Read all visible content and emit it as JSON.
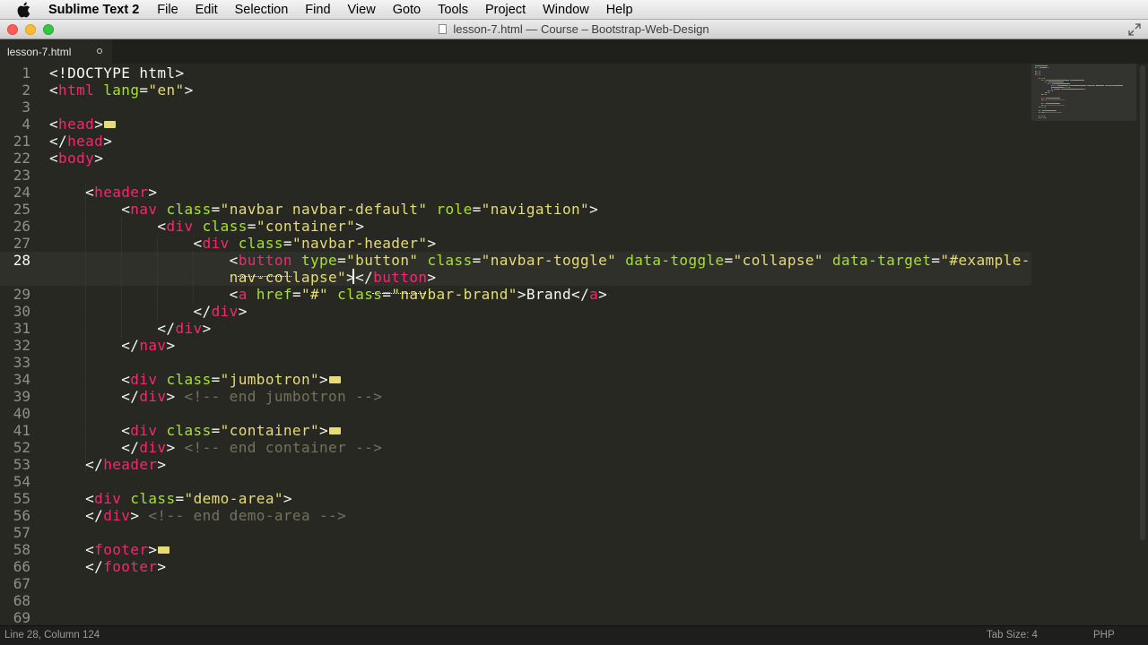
{
  "menubar": {
    "app_name": "Sublime Text 2",
    "items": [
      "File",
      "Edit",
      "Selection",
      "Find",
      "View",
      "Goto",
      "Tools",
      "Project",
      "Window",
      "Help"
    ]
  },
  "window": {
    "title": "lesson-7.html — Course – Bootstrap-Web-Design"
  },
  "tab": {
    "label": "lesson-7.html",
    "dirty": true
  },
  "editor": {
    "current_line": "28",
    "lines": [
      {
        "n": "1",
        "tokens": [
          [
            "pun",
            "<!DOCTYPE html>"
          ]
        ]
      },
      {
        "n": "2",
        "tokens": [
          [
            "pun",
            "<"
          ],
          [
            "tag",
            "html"
          ],
          [
            "pun",
            " "
          ],
          [
            "attr",
            "lang"
          ],
          [
            "pun",
            "="
          ],
          [
            "str",
            "\"en\""
          ],
          [
            "pun",
            ">"
          ]
        ]
      },
      {
        "n": "3",
        "tokens": []
      },
      {
        "n": "4",
        "tokens": [
          [
            "pun",
            "<"
          ],
          [
            "tag",
            "head"
          ],
          [
            "pun",
            ">"
          ],
          [
            "fold",
            ""
          ]
        ]
      },
      {
        "n": "21",
        "tokens": [
          [
            "pun",
            "</"
          ],
          [
            "tag",
            "head"
          ],
          [
            "pun",
            ">"
          ]
        ]
      },
      {
        "n": "22",
        "tokens": [
          [
            "pun",
            "<"
          ],
          [
            "tag",
            "body"
          ],
          [
            "pun",
            ">"
          ]
        ]
      },
      {
        "n": "23",
        "tokens": []
      },
      {
        "n": "24",
        "tokens": [
          [
            "pun",
            "    <"
          ],
          [
            "tag",
            "header"
          ],
          [
            "pun",
            ">"
          ]
        ]
      },
      {
        "n": "25",
        "tokens": [
          [
            "pun",
            "        <"
          ],
          [
            "tag",
            "nav"
          ],
          [
            "pun",
            " "
          ],
          [
            "attr",
            "class"
          ],
          [
            "pun",
            "="
          ],
          [
            "str",
            "\"navbar navbar-default\""
          ],
          [
            "pun",
            " "
          ],
          [
            "attr",
            "role"
          ],
          [
            "pun",
            "="
          ],
          [
            "str",
            "\"navigation\""
          ],
          [
            "pun",
            ">"
          ]
        ]
      },
      {
        "n": "26",
        "tokens": [
          [
            "pun",
            "            <"
          ],
          [
            "tag",
            "div"
          ],
          [
            "pun",
            " "
          ],
          [
            "attr",
            "class"
          ],
          [
            "pun",
            "="
          ],
          [
            "str",
            "\"container\""
          ],
          [
            "pun",
            ">"
          ]
        ]
      },
      {
        "n": "27",
        "tokens": [
          [
            "pun",
            "                <"
          ],
          [
            "tag",
            "div"
          ],
          [
            "pun",
            " "
          ],
          [
            "attr",
            "class"
          ],
          [
            "pun",
            "="
          ],
          [
            "str",
            "\"navbar-header\""
          ],
          [
            "pun",
            ">"
          ]
        ]
      },
      {
        "n": "28",
        "tokens": [
          [
            "pun",
            "                    <"
          ],
          [
            "tag",
            "button"
          ],
          [
            "pun",
            " "
          ],
          [
            "attr",
            "type"
          ],
          [
            "pun",
            "="
          ],
          [
            "str",
            "\"button\""
          ],
          [
            "pun",
            " "
          ],
          [
            "attr",
            "class"
          ],
          [
            "pun",
            "="
          ],
          [
            "str",
            "\"navbar-toggle\""
          ],
          [
            "pun",
            " "
          ],
          [
            "attr",
            "data-toggle"
          ],
          [
            "pun",
            "="
          ],
          [
            "str",
            "\"collapse\""
          ],
          [
            "pun",
            " "
          ],
          [
            "attr",
            "data-target"
          ],
          [
            "pun",
            "="
          ],
          [
            "str",
            "\"#example-"
          ]
        ]
      },
      {
        "n": "",
        "tokens": [
          [
            "pun",
            "                    "
          ],
          [
            "str",
            "nav-collapse\""
          ],
          [
            "pun",
            ">"
          ],
          [
            "pun",
            "</"
          ],
          [
            "tag",
            "button"
          ],
          [
            "pun",
            ">"
          ]
        ]
      },
      {
        "n": "29",
        "tokens": [
          [
            "pun",
            "                    <"
          ],
          [
            "tag",
            "a"
          ],
          [
            "pun",
            " "
          ],
          [
            "attr",
            "href"
          ],
          [
            "pun",
            "="
          ],
          [
            "str",
            "\"#\""
          ],
          [
            "pun",
            " "
          ],
          [
            "attr",
            "class"
          ],
          [
            "pun",
            "="
          ],
          [
            "str",
            "\"navbar-brand\""
          ],
          [
            "pun",
            ">"
          ],
          [
            "txt",
            "Brand"
          ],
          [
            "pun",
            "</"
          ],
          [
            "tag",
            "a"
          ],
          [
            "pun",
            ">"
          ]
        ]
      },
      {
        "n": "30",
        "tokens": [
          [
            "pun",
            "                </"
          ],
          [
            "tag",
            "div"
          ],
          [
            "pun",
            ">"
          ]
        ]
      },
      {
        "n": "31",
        "tokens": [
          [
            "pun",
            "            </"
          ],
          [
            "tag",
            "div"
          ],
          [
            "pun",
            ">"
          ]
        ]
      },
      {
        "n": "32",
        "tokens": [
          [
            "pun",
            "        </"
          ],
          [
            "tag",
            "nav"
          ],
          [
            "pun",
            ">"
          ]
        ]
      },
      {
        "n": "33",
        "tokens": []
      },
      {
        "n": "34",
        "tokens": [
          [
            "pun",
            "        <"
          ],
          [
            "tag",
            "div"
          ],
          [
            "pun",
            " "
          ],
          [
            "attr",
            "class"
          ],
          [
            "pun",
            "="
          ],
          [
            "str",
            "\"jumbotron\""
          ],
          [
            "pun",
            ">"
          ],
          [
            "fold",
            ""
          ]
        ]
      },
      {
        "n": "39",
        "tokens": [
          [
            "pun",
            "        </"
          ],
          [
            "tag",
            "div"
          ],
          [
            "pun",
            "> "
          ],
          [
            "com",
            "<!-- end jumbotron -->"
          ]
        ]
      },
      {
        "n": "40",
        "tokens": []
      },
      {
        "n": "41",
        "tokens": [
          [
            "pun",
            "        <"
          ],
          [
            "tag",
            "div"
          ],
          [
            "pun",
            " "
          ],
          [
            "attr",
            "class"
          ],
          [
            "pun",
            "="
          ],
          [
            "str",
            "\"container\""
          ],
          [
            "pun",
            ">"
          ],
          [
            "fold",
            ""
          ]
        ]
      },
      {
        "n": "52",
        "tokens": [
          [
            "pun",
            "        </"
          ],
          [
            "tag",
            "div"
          ],
          [
            "pun",
            "> "
          ],
          [
            "com",
            "<!-- end container -->"
          ]
        ]
      },
      {
        "n": "53",
        "tokens": [
          [
            "pun",
            "    </"
          ],
          [
            "tag",
            "header"
          ],
          [
            "pun",
            ">"
          ]
        ]
      },
      {
        "n": "54",
        "tokens": []
      },
      {
        "n": "55",
        "tokens": [
          [
            "pun",
            "    <"
          ],
          [
            "tag",
            "div"
          ],
          [
            "pun",
            " "
          ],
          [
            "attr",
            "class"
          ],
          [
            "pun",
            "="
          ],
          [
            "str",
            "\"demo-area\""
          ],
          [
            "pun",
            ">"
          ]
        ]
      },
      {
        "n": "56",
        "tokens": [
          [
            "pun",
            "    </"
          ],
          [
            "tag",
            "div"
          ],
          [
            "pun",
            "> "
          ],
          [
            "com",
            "<!-- end demo-area -->"
          ]
        ]
      },
      {
        "n": "57",
        "tokens": []
      },
      {
        "n": "58",
        "tokens": [
          [
            "pun",
            "    <"
          ],
          [
            "tag",
            "footer"
          ],
          [
            "pun",
            ">"
          ],
          [
            "fold",
            ""
          ]
        ]
      },
      {
        "n": "66",
        "tokens": [
          [
            "pun",
            "    </"
          ],
          [
            "tag",
            "footer"
          ],
          [
            "pun",
            ">"
          ]
        ]
      },
      {
        "n": "67",
        "tokens": []
      },
      {
        "n": "68",
        "tokens": []
      },
      {
        "n": "69",
        "tokens": []
      }
    ]
  },
  "statusbar": {
    "position": "Line 28, Column 124",
    "tab_size": "Tab Size: 4",
    "syntax": "PHP"
  },
  "colors": {
    "background": "#272822",
    "tag": "#f92672",
    "attribute": "#a6e22e",
    "string": "#e6db74",
    "comment": "#75715e",
    "foreground": "#f8f8f2"
  }
}
